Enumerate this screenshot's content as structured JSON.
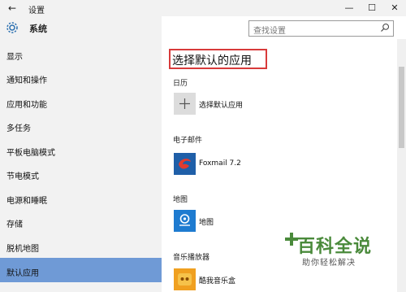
{
  "window": {
    "title": "设置",
    "back_glyph": "←",
    "min_glyph": "—",
    "max_glyph": "☐",
    "close_glyph": "✕"
  },
  "header": {
    "app_title": "系统",
    "icon": "gear-icon"
  },
  "search": {
    "placeholder": "查找设置",
    "icon": "search-icon"
  },
  "sidebar": {
    "items": [
      {
        "label": "显示"
      },
      {
        "label": "通知和操作"
      },
      {
        "label": "应用和功能"
      },
      {
        "label": "多任务"
      },
      {
        "label": "平板电脑模式"
      },
      {
        "label": "节电模式"
      },
      {
        "label": "电源和睡眠"
      },
      {
        "label": "存储"
      },
      {
        "label": "脱机地图"
      },
      {
        "label": "默认应用",
        "active": true
      }
    ],
    "active_color": "#6f9ad6"
  },
  "main": {
    "page_title": "选择默认的应用",
    "sections": [
      {
        "label": "日历",
        "app_name": "选择默认应用",
        "icon": "plus-icon"
      },
      {
        "label": "电子邮件",
        "app_name": "Foxmail 7.2",
        "icon": "foxmail-icon"
      },
      {
        "label": "地图",
        "app_name": "地图",
        "icon": "maps-icon"
      },
      {
        "label": "音乐播放器",
        "app_name": "酷我音乐盒",
        "icon": "kuwo-music-icon"
      }
    ],
    "highlight_color": "#d83a3a"
  },
  "watermark": {
    "title": "百科全说",
    "subtitle": "助你轻松解决"
  }
}
